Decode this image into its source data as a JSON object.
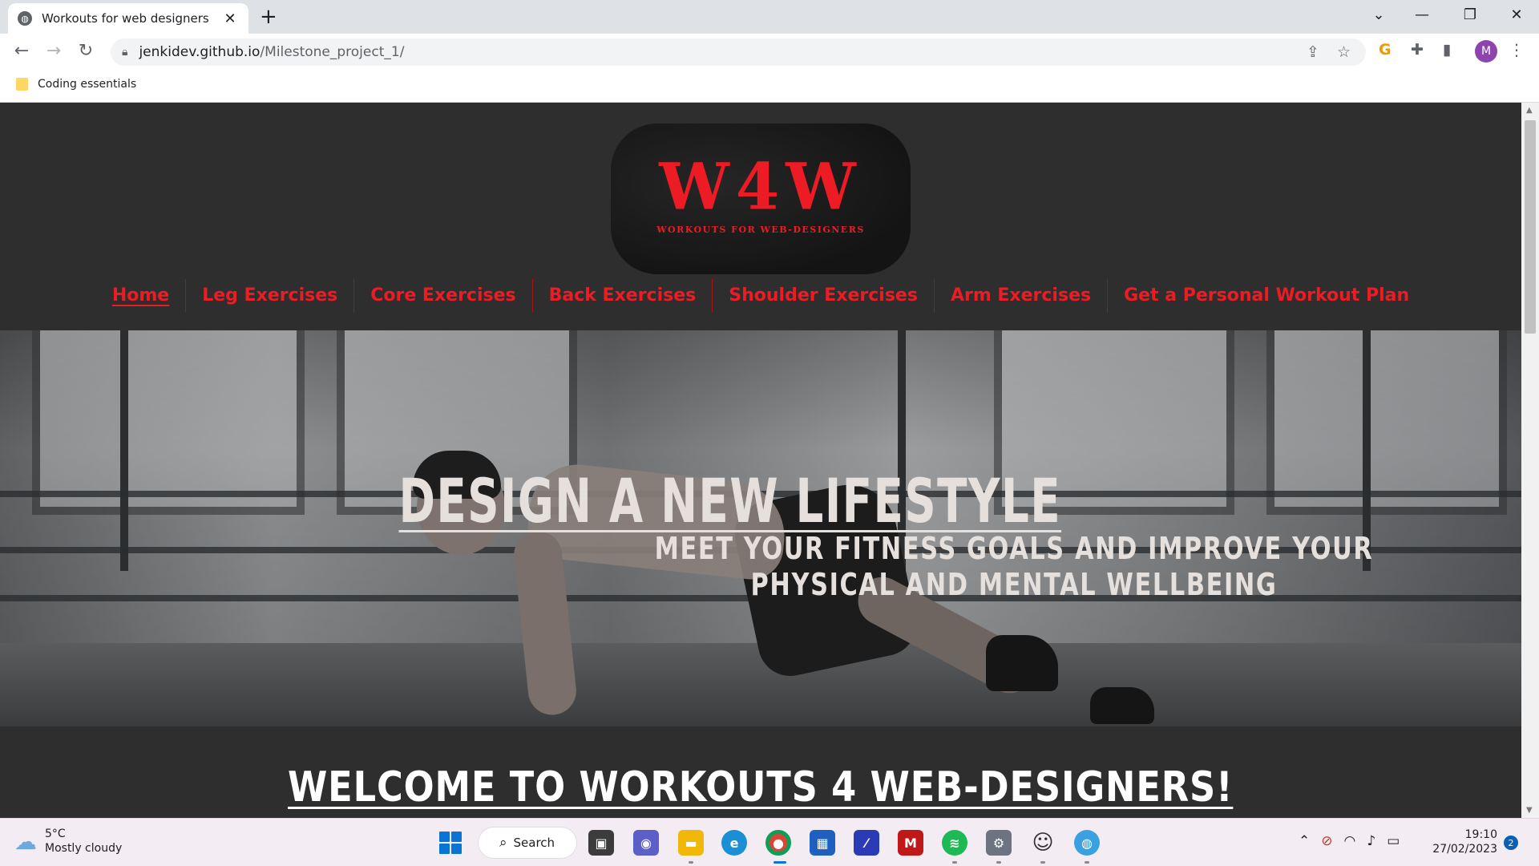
{
  "browser": {
    "tab_title": "Workouts for web designers",
    "tab_close": "✕",
    "new_tab": "+",
    "url_host": "jenkidev.github.io",
    "url_path": "/Milestone_project_1/",
    "bookmark_label": "Coding essentials",
    "profile_initial": "M"
  },
  "logo": {
    "main": "W4W",
    "sub": "WORKOUTS FOR WEB-DESIGNERS"
  },
  "nav": {
    "items": [
      {
        "label": "Home",
        "active": true
      },
      {
        "label": "Leg Exercises"
      },
      {
        "label": "Core Exercises"
      },
      {
        "label": "Back Exercises"
      },
      {
        "label": "Shoulder Exercises"
      },
      {
        "label": "Arm Exercises"
      },
      {
        "label": "Get a Personal Workout Plan"
      }
    ]
  },
  "hero": {
    "title": "DESIGN A NEW LIFESTYLE",
    "subtitle": "MEET YOUR FITNESS GOALS AND IMPROVE YOUR PHYSICAL AND MENTAL WELLBEING"
  },
  "welcome": {
    "heading": "WELCOME TO WORKOUTS 4 WEB-DESIGNERS!"
  },
  "taskbar": {
    "weather_temp": "5°C",
    "weather_desc": "Mostly cloudy",
    "search_label": "Search",
    "time": "19:10",
    "date": "27/02/2023",
    "notification_count": "2"
  },
  "colors": {
    "brand_red": "#ed1c24",
    "page_bg": "#2e2e2e"
  }
}
